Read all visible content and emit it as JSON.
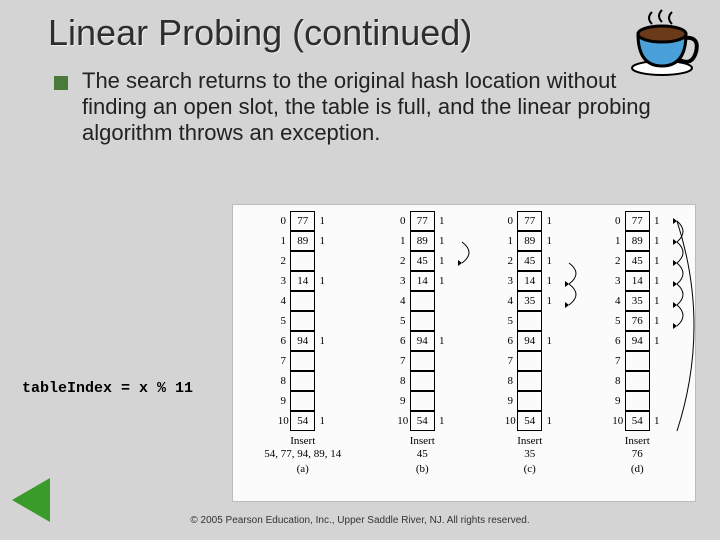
{
  "title": "Linear Probing (continued)",
  "bullet_text": "The search returns to the original hash location without finding an open slot, the table is full, and the linear probing algorithm throws an exception.",
  "formula": "tableIndex = x % 11",
  "footer": "© 2005 Pearson Education, Inc., Upper Saddle River, NJ.  All rights reserved.",
  "tables": [
    {
      "rows": [
        {
          "i": "0",
          "v": "77",
          "r": "1"
        },
        {
          "i": "1",
          "v": "89",
          "r": "1"
        },
        {
          "i": "2",
          "v": "",
          "r": ""
        },
        {
          "i": "3",
          "v": "14",
          "r": "1"
        },
        {
          "i": "4",
          "v": "",
          "r": ""
        },
        {
          "i": "5",
          "v": "",
          "r": ""
        },
        {
          "i": "6",
          "v": "94",
          "r": "1"
        },
        {
          "i": "7",
          "v": "",
          "r": ""
        },
        {
          "i": "8",
          "v": "",
          "r": ""
        },
        {
          "i": "9",
          "v": "",
          "r": ""
        },
        {
          "i": "10",
          "v": "54",
          "r": "1"
        }
      ],
      "caption_l1": "Insert",
      "caption_l2": "54, 77, 94, 89, 14",
      "sub": "(a)"
    },
    {
      "rows": [
        {
          "i": "0",
          "v": "77",
          "r": "1"
        },
        {
          "i": "1",
          "v": "89",
          "r": "1"
        },
        {
          "i": "2",
          "v": "45",
          "r": "1"
        },
        {
          "i": "3",
          "v": "14",
          "r": "1"
        },
        {
          "i": "4",
          "v": "",
          "r": ""
        },
        {
          "i": "5",
          "v": "",
          "r": ""
        },
        {
          "i": "6",
          "v": "94",
          "r": "1"
        },
        {
          "i": "7",
          "v": "",
          "r": ""
        },
        {
          "i": "8",
          "v": "",
          "r": ""
        },
        {
          "i": "9",
          "v": "",
          "r": ""
        },
        {
          "i": "10",
          "v": "54",
          "r": "1"
        }
      ],
      "caption_l1": "Insert",
      "caption_l2": "45",
      "sub": "(b)"
    },
    {
      "rows": [
        {
          "i": "0",
          "v": "77",
          "r": "1"
        },
        {
          "i": "1",
          "v": "89",
          "r": "1"
        },
        {
          "i": "2",
          "v": "45",
          "r": "1"
        },
        {
          "i": "3",
          "v": "14",
          "r": "1"
        },
        {
          "i": "4",
          "v": "35",
          "r": "1"
        },
        {
          "i": "5",
          "v": "",
          "r": ""
        },
        {
          "i": "6",
          "v": "94",
          "r": "1"
        },
        {
          "i": "7",
          "v": "",
          "r": ""
        },
        {
          "i": "8",
          "v": "",
          "r": ""
        },
        {
          "i": "9",
          "v": "",
          "r": ""
        },
        {
          "i": "10",
          "v": "54",
          "r": "1"
        }
      ],
      "caption_l1": "Insert",
      "caption_l2": "35",
      "sub": "(c)"
    },
    {
      "rows": [
        {
          "i": "0",
          "v": "77",
          "r": "1"
        },
        {
          "i": "1",
          "v": "89",
          "r": "1"
        },
        {
          "i": "2",
          "v": "45",
          "r": "1"
        },
        {
          "i": "3",
          "v": "14",
          "r": "1"
        },
        {
          "i": "4",
          "v": "35",
          "r": "1"
        },
        {
          "i": "5",
          "v": "76",
          "r": "1"
        },
        {
          "i": "6",
          "v": "94",
          "r": "1"
        },
        {
          "i": "7",
          "v": "",
          "r": ""
        },
        {
          "i": "8",
          "v": "",
          "r": ""
        },
        {
          "i": "9",
          "v": "",
          "r": ""
        },
        {
          "i": "10",
          "v": "54",
          "r": "1"
        }
      ],
      "caption_l1": "Insert",
      "caption_l2": "76",
      "sub": "(d)"
    }
  ]
}
